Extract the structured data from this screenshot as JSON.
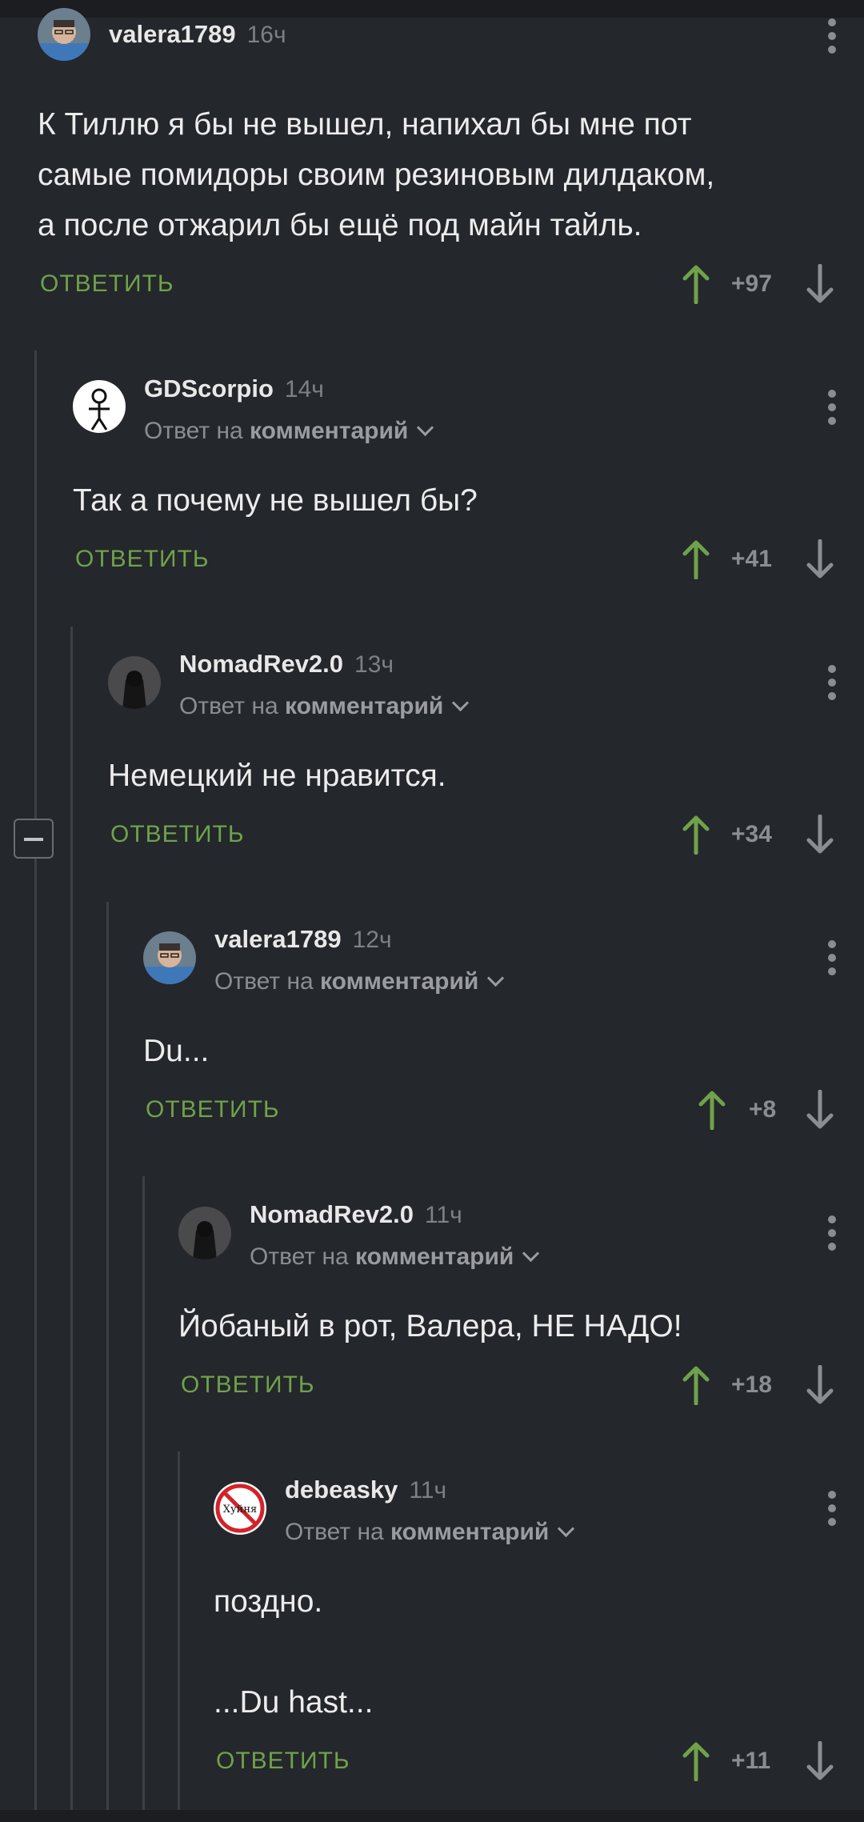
{
  "reply_label": "ОТВЕТИТЬ",
  "reply_prefix": "Ответ на",
  "reply_target": "комментарий",
  "comments": [
    {
      "author": "valera1789",
      "time": "16ч",
      "text": "К Тиллю я бы не вышел, напихал бы мне пот\nсамые помидоры своим резиновым дилдаком,\nа после отжарил бы ещё под майн тайль.",
      "score": "+97"
    },
    {
      "author": "GDScorpio",
      "time": "14ч",
      "text": "Так а почему не вышел бы?",
      "score": "+41"
    },
    {
      "author": "NomadRev2.0",
      "time": "13ч",
      "text": "Немецкий не нравится.",
      "score": "+34"
    },
    {
      "author": "valera1789",
      "time": "12ч",
      "text": "Du...",
      "score": "+8"
    },
    {
      "author": "NomadRev2.0",
      "time": "11ч",
      "text": "Йобаный в рот, Валера, НЕ НАДО!",
      "score": "+18"
    },
    {
      "author": "debeasky",
      "time": "11ч",
      "text": "поздно.\n\n...Du hast...",
      "score": "+11",
      "avatar_text": "Хуйня"
    }
  ],
  "colors": {
    "background": "#24272b",
    "accent_green": "#6fa24a",
    "muted": "#8a8d92"
  }
}
